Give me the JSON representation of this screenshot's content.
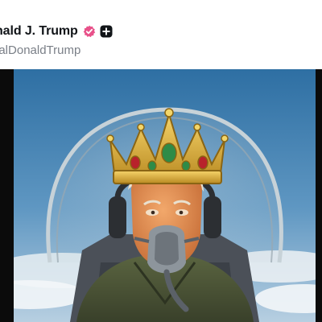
{
  "post": {
    "display_name": "nald J. Trump",
    "handle": "ealDonaldTrump",
    "verified_badge_color": "#e8518a",
    "add_button_color": "#111418"
  },
  "media": {
    "kind": "image",
    "description_icon": "ai-generated-portrait-image"
  }
}
